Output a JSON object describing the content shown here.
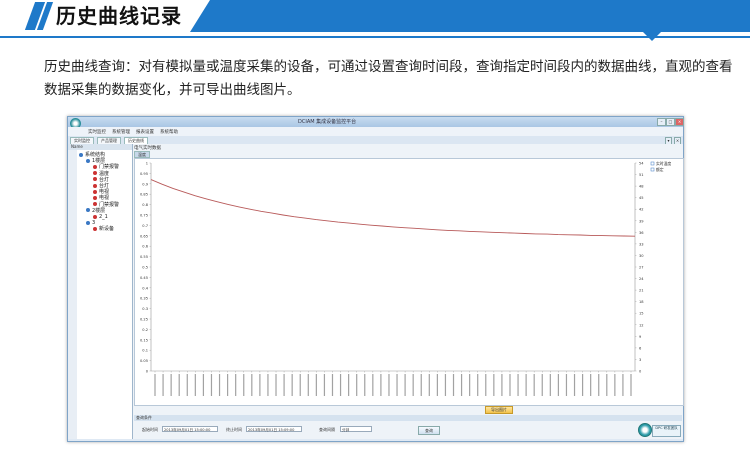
{
  "header": {
    "title": "历史曲线记录",
    "accent_color": "#1e79c9"
  },
  "description": "历史曲线查询：对有模拟量或温度采集的设备，可通过设置查询时间段，查询指定时间段内的数据曲线，直观的查看数据采集的数据变化，并可导出曲线图片。",
  "app": {
    "window_title": "DCIAM 集成设备监控平台",
    "menu": [
      "实时监控",
      "系统管理",
      "报表设置",
      "系统帮助"
    ],
    "tabs": [
      "实时监控",
      "产品管理",
      "历史曲线"
    ],
    "sidebar_header": "Name",
    "tree": [
      {
        "label": "系统结构",
        "level": 0,
        "icon": "computer-icon"
      },
      {
        "label": "1楼层",
        "level": 1,
        "icon": "folder-icon"
      },
      {
        "label": "门禁报警",
        "level": 2,
        "icon": "sensor-icon"
      },
      {
        "label": "温度",
        "level": 2,
        "icon": "sensor-icon"
      },
      {
        "label": "台灯",
        "level": 2,
        "icon": "sensor-icon"
      },
      {
        "label": "台灯",
        "level": 2,
        "icon": "sensor-icon"
      },
      {
        "label": "电视",
        "level": 2,
        "icon": "sensor-icon"
      },
      {
        "label": "电视",
        "level": 2,
        "icon": "sensor-icon"
      },
      {
        "label": "门禁报警",
        "level": 2,
        "icon": "sensor-icon"
      },
      {
        "label": "2楼层",
        "level": 1,
        "icon": "folder-icon"
      },
      {
        "label": "2_1",
        "level": 2,
        "icon": "sensor-icon"
      },
      {
        "label": "3",
        "level": 1,
        "icon": "folder-icon"
      },
      {
        "label": "新设备",
        "level": 2,
        "icon": "sensor-icon"
      }
    ],
    "panel_title": "电气实时数据",
    "chart_tab": "温度",
    "legend": [
      "实时温度",
      "额定"
    ],
    "export_button": "导出图片",
    "query_header": "查询条件",
    "query": {
      "start_label": "起始时间",
      "start_value": "2013年09月01日 15:00:00",
      "end_label": "终止时间",
      "end_value": "2013年09月01日 15:09:00",
      "interval_label": "查询间隔",
      "interval_value": "分钟",
      "query_button": "查询"
    },
    "vendor_badge": "DPC 研发团队"
  },
  "chart_data": {
    "type": "line",
    "series": [
      {
        "name": "实时温度",
        "color": "#b85a5a",
        "values": [
          0.92,
          0.898,
          0.878,
          0.86,
          0.843,
          0.828,
          0.814,
          0.801,
          0.789,
          0.778,
          0.768,
          0.759,
          0.75,
          0.742,
          0.735,
          0.728,
          0.722,
          0.716,
          0.711,
          0.706,
          0.701,
          0.697,
          0.693,
          0.689,
          0.686,
          0.682,
          0.679,
          0.676,
          0.674,
          0.671,
          0.669,
          0.667,
          0.665,
          0.663,
          0.661,
          0.659,
          0.658,
          0.656,
          0.655,
          0.654,
          0.652,
          0.651,
          0.65,
          0.649,
          0.648
        ]
      }
    ],
    "ylim_left": [
      0,
      1
    ],
    "left_ticks": [
      "1",
      "0.95",
      "0.9",
      "0.85",
      "0.8",
      "0.75",
      "0.7",
      "0.65",
      "0.6",
      "0.55",
      "0.5",
      "0.45",
      "0.4",
      "0.35",
      "0.3",
      "0.25",
      "0.2",
      "0.15",
      "0.1",
      "0.05",
      "0"
    ],
    "ylim_right": [
      0,
      54
    ],
    "right_ticks": [
      "54",
      "51",
      "48",
      "45",
      "42",
      "39",
      "36",
      "33",
      "30",
      "27",
      "24",
      "21",
      "18",
      "15",
      "12",
      "9",
      "6",
      "3",
      "0"
    ],
    "x_tick_count": 60,
    "grid": false,
    "legend_position": "top-right"
  }
}
